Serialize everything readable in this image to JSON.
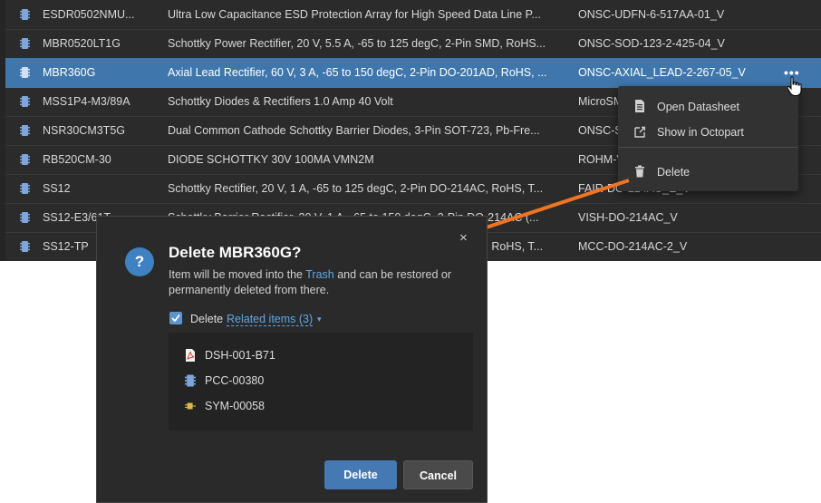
{
  "table": {
    "rows": [
      {
        "name": "ESDR0502NMU...",
        "description": "Ultra Low Capacitance ESD Protection Array for High Speed Data Line P...",
        "footprint": "ONSC-UDFN-6-517AA-01_V",
        "selected": false
      },
      {
        "name": "MBR0520LT1G",
        "description": "Schottky Power Rectifier, 20 V, 5.5 A, -65 to 125 degC, 2-Pin SMD, RoHS...",
        "footprint": "ONSC-SOD-123-2-425-04_V",
        "selected": false
      },
      {
        "name": "MBR360G",
        "description": "Axial Lead Rectifier, 60 V, 3 A, -65 to 150 degC, 2-Pin DO-201AD, RoHS, ...",
        "footprint": "ONSC-AXIAL_LEAD-2-267-05_V",
        "selected": true
      },
      {
        "name": "MSS1P4-M3/89A",
        "description": "Schottky Diodes & Rectifiers 1.0 Amp 40 Volt",
        "footprint": "MicroSM",
        "selected": false
      },
      {
        "name": "NSR30CM3T5G",
        "description": "Dual Common Cathode Schottky Barrier Diodes, 3-Pin SOT-723, Pb-Fre...",
        "footprint": "ONSC-S",
        "selected": false
      },
      {
        "name": "RB520CM-30",
        "description": "DIODE SCHOTTKY 30V 100MA VMN2M",
        "footprint": "ROHM-V",
        "selected": false
      },
      {
        "name": "SS12",
        "description": "Schottky Rectifier, 20 V, 1 A, -65 to 125 degC, 2-Pin DO-214AC, RoHS, T...",
        "footprint": "FAIR-DO-214AC_E_V",
        "selected": false
      },
      {
        "name": "SS12-E3/61T",
        "description": "Schottky Barrier Rectifier, 20 V, 1 A, -65 to 150 degC, 2-Pin DO-214AC (...",
        "footprint": "VISH-DO-214AC_V",
        "selected": false
      },
      {
        "name": "SS12-TP",
        "description": "Schottky Rectifier, 20 V, 1 A, -65 to 125 degC, 2-Pin DO-214AC, RoHS, T...",
        "footprint": "MCC-DO-214AC-2_V",
        "selected": false
      }
    ],
    "more_glyph": "•••"
  },
  "context_menu": {
    "items": [
      {
        "label": "Open Datasheet",
        "icon": "document-icon"
      },
      {
        "label": "Show in Octopart",
        "icon": "external-link-icon"
      },
      {
        "label": "Delete",
        "icon": "trash-icon"
      }
    ]
  },
  "dialog": {
    "icon_glyph": "?",
    "title": "Delete MBR360G?",
    "close_glyph": "×",
    "message_before": "Item will be moved into the ",
    "message_link": "Trash",
    "message_after": " and can be restored or permanently deleted from there.",
    "checkbox_label": "Delete",
    "checkbox_checked": true,
    "related_label": "Related items (3)",
    "caret_glyph": "▾",
    "related_items": [
      {
        "label": "DSH-001-B71",
        "icon": "pdf-file-icon"
      },
      {
        "label": "PCC-00380",
        "icon": "component-chip-icon"
      },
      {
        "label": "SYM-00058",
        "icon": "symbol-icon"
      }
    ],
    "buttons": {
      "primary": "Delete",
      "secondary": "Cancel"
    }
  },
  "colors": {
    "accent": "#3f77ad",
    "arrow": "#f07424",
    "link": "#5fa8e8",
    "background": "#2b2b2b"
  }
}
